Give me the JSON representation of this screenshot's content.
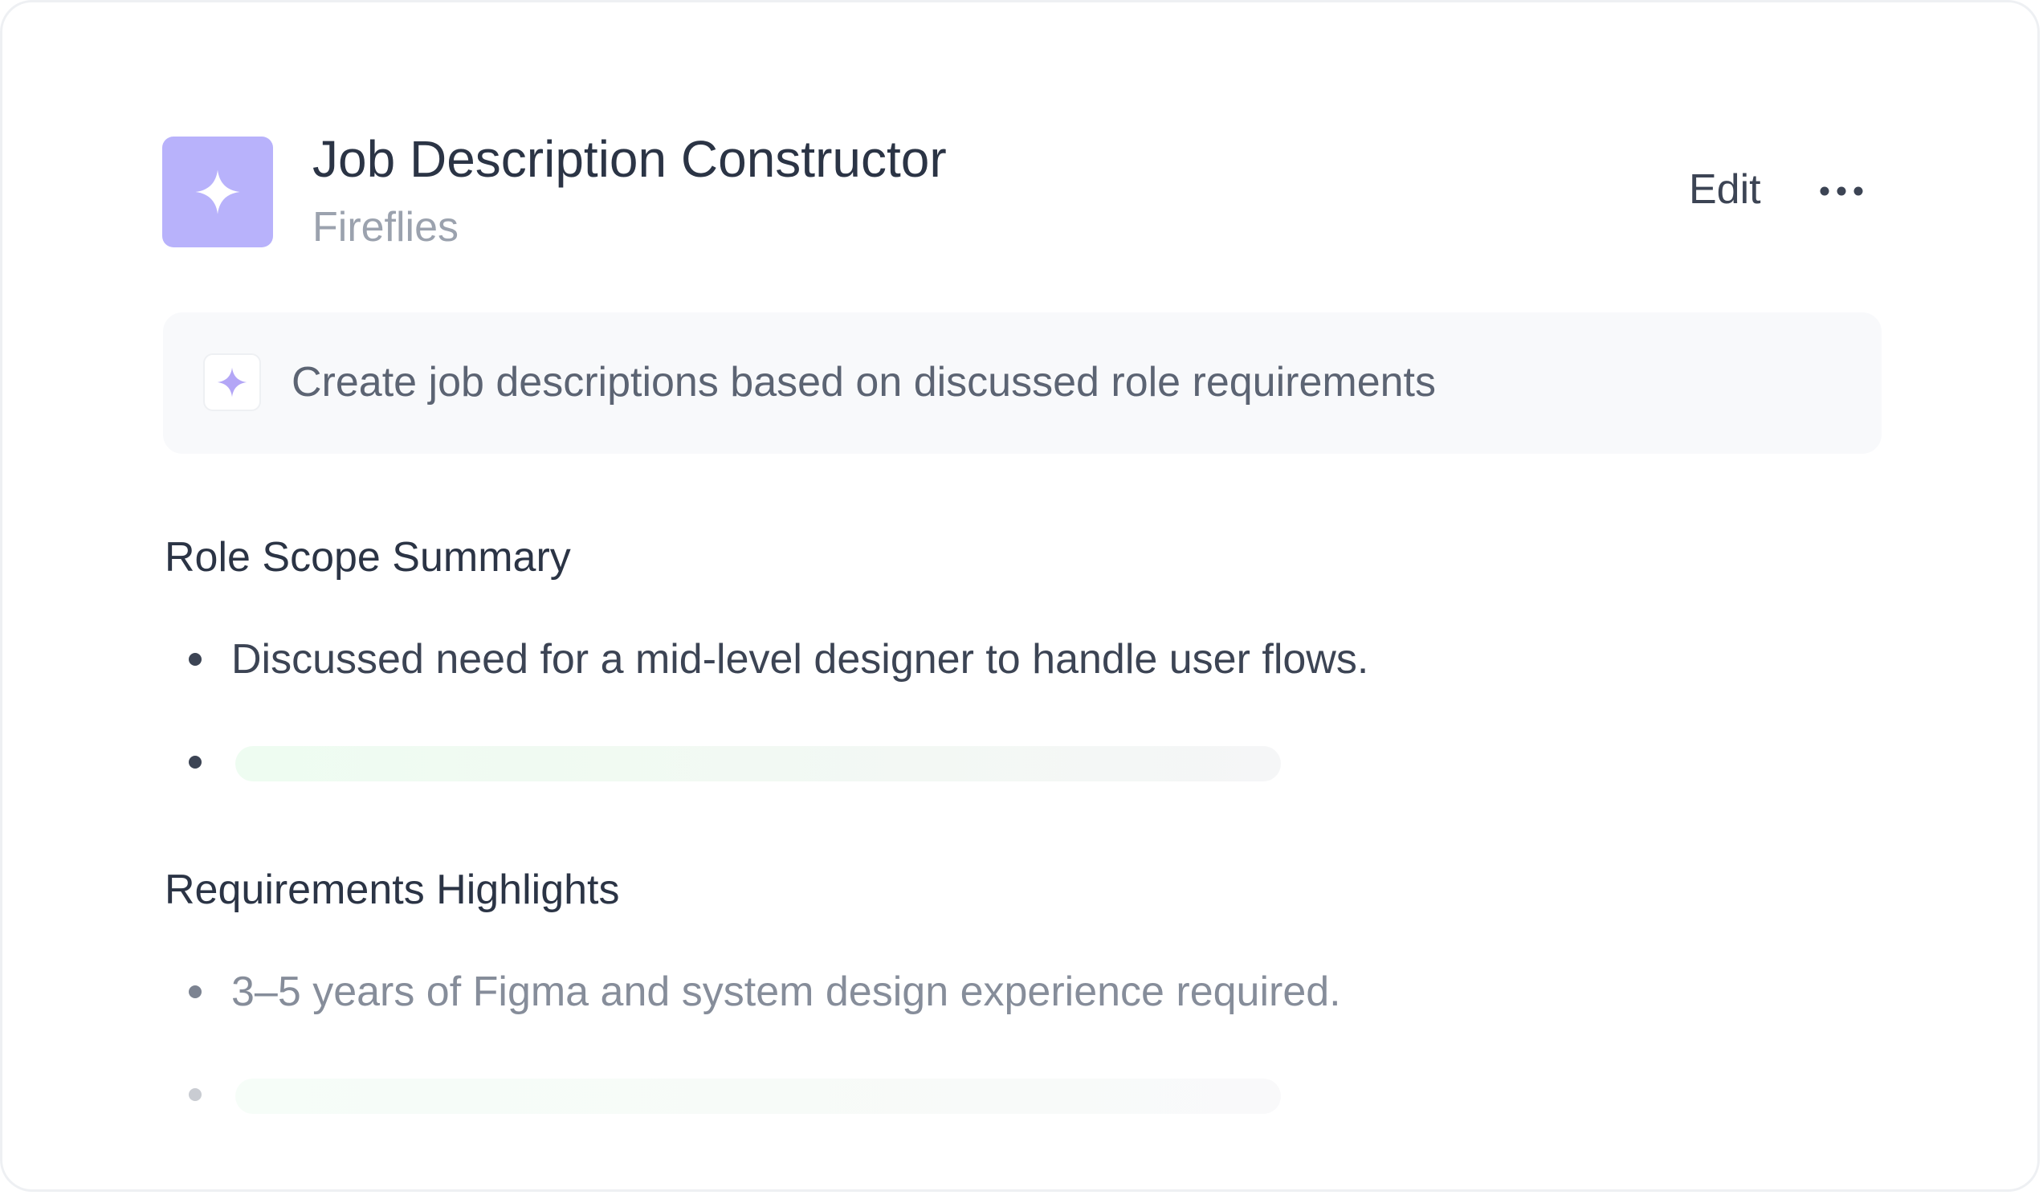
{
  "header": {
    "title": "Job Description Constructor",
    "subtitle": "Fireflies",
    "edit_label": "Edit",
    "app_icon": "sparkle-icon",
    "more_icon": "more-horizontal-icon",
    "accent_color": "#b8b2fb"
  },
  "prompt": {
    "icon": "sparkle-icon",
    "text": "Create job descriptions based on discussed role requirements"
  },
  "sections": [
    {
      "title": "Role Scope Summary",
      "items": [
        {
          "text": "Discussed need for a mid-level designer to handle user flows."
        },
        {
          "text": "",
          "loading": true
        }
      ]
    },
    {
      "title": "Requirements Highlights",
      "items": [
        {
          "text": "3–5 years of Figma and system design experience required."
        },
        {
          "text": "",
          "loading": true
        }
      ]
    }
  ]
}
